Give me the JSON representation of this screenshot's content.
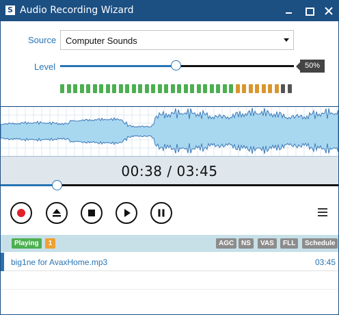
{
  "window": {
    "title": "Audio Recording Wizard",
    "app_icon_glyph": "S",
    "controls": [
      "minimize-icon",
      "maximize-icon",
      "close-icon"
    ]
  },
  "source": {
    "label": "Source",
    "selected": "Computer Sounds"
  },
  "level": {
    "label": "Level",
    "percent": 50,
    "display": "50%"
  },
  "vu_meter": {
    "segments_total": 36,
    "segments_green": 27,
    "segments_orange": 7,
    "segments_off": 6
  },
  "playback": {
    "time_display": "00:38 / 03:45",
    "position_fraction": 0.169
  },
  "transport": {
    "buttons": [
      "record-icon",
      "eject-icon",
      "stop-icon",
      "play-icon",
      "pause-icon"
    ],
    "menu_icon": "menu-icon"
  },
  "playlist": {
    "status": "Playing",
    "count": "1",
    "tags": [
      "AGC",
      "NS",
      "VAS",
      "FLL",
      "Schedule"
    ],
    "items": [
      {
        "name": "big1ne for AvaxHome.mp3",
        "duration": "03:45"
      }
    ]
  },
  "colors": {
    "title_bar": "#1c4f82",
    "accent": "#2874b3",
    "vu_green": "#4caf50",
    "vu_orange": "#d9962f",
    "vu_off": "#555555",
    "waveform_fill": "#a8d8f0",
    "waveform_stroke": "#3d78b8",
    "playing_badge": "#4caf50",
    "count_badge": "#f0a030",
    "playlist_header": "#c7e0e8"
  }
}
